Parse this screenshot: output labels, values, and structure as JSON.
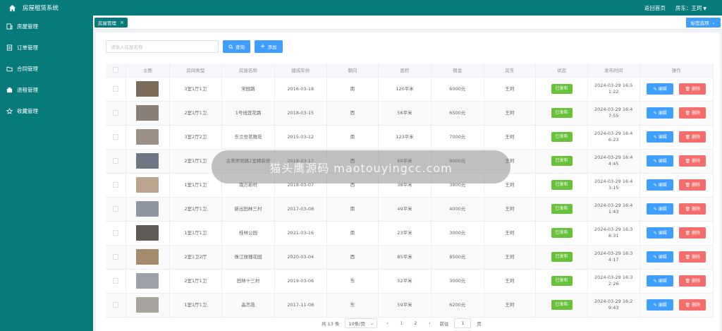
{
  "header": {
    "brand": "房屋租赁系统",
    "back_home": "返回首页",
    "user": "房东：王珂",
    "home_icon": "home-icon"
  },
  "sidebar": {
    "items": [
      {
        "label": "房屋管理",
        "icon": "building-icon"
      },
      {
        "label": "订单管理",
        "icon": "order-icon"
      },
      {
        "label": "合同管理",
        "icon": "folder-icon"
      },
      {
        "label": "退租管理",
        "icon": "checkout-icon"
      },
      {
        "label": "收藏管理",
        "icon": "star-icon"
      }
    ]
  },
  "tags": {
    "active_tag": "房屋管理",
    "close_symbol": "×",
    "options_label": "标签选项"
  },
  "toolbar": {
    "search_placeholder": "请输入房屋名称",
    "search_label": "查询",
    "add_label": "添加"
  },
  "table": {
    "columns": [
      "主图",
      "房间类型",
      "房屋名称",
      "建成年份",
      "朝向",
      "面积",
      "租金",
      "房东",
      "状态",
      "发布时间",
      "操作"
    ],
    "edit_label": "编辑",
    "delete_label": "删除",
    "rows": [
      {
        "type": "3室1厅1卫",
        "name": "宋园路",
        "year": "2016-03-18",
        "dir": "南",
        "area": "120平米",
        "rent": "6000元",
        "owner": "王珂",
        "status": "已发布",
        "time": "2024-03-29 16:5 1:22",
        "thumb": "#7b6a58"
      },
      {
        "type": "2室1厅1卫",
        "name": "1号线莲花路",
        "year": "2018-03-15",
        "dir": "西",
        "area": "56平米",
        "rent": "6500元",
        "owner": "王珂",
        "status": "已发布",
        "time": "2024-03-29 16:4 7:55",
        "thumb": "#8a7f76"
      },
      {
        "type": "3室2厅2卫",
        "name": "东兰世茗雅苑",
        "year": "2015-03-12",
        "dir": "南",
        "area": "123平米",
        "rent": "7000元",
        "owner": "王珂",
        "status": "已发布",
        "time": "2024-03-29 16:4 6:23",
        "thumb": "#9c8f86"
      },
      {
        "type": "2室1厅1卫",
        "name": "古美罗阳路2室精装修",
        "year": "2018-03-17",
        "dir": "西",
        "area": "60平米",
        "rent": "6000元",
        "owner": "王珂",
        "status": "已发布",
        "time": "2024-03-29 16:4 4:45",
        "thumb": "#6f7784"
      },
      {
        "type": "1室1厅1卫",
        "name": "南方新村",
        "year": "2018-03-07",
        "dir": "西",
        "area": "38平米",
        "rent": "3800元",
        "owner": "王珂",
        "status": "已发布",
        "time": "2024-03-29 16:4 3:15",
        "thumb": "#b9a58b"
      },
      {
        "type": "2室1厅1卫",
        "name": "新出田林三村",
        "year": "2017-03-08",
        "dir": "南",
        "area": "49平米",
        "rent": "4000元",
        "owner": "王珂",
        "status": "已发布",
        "time": "2024-03-29 16:4 1:43",
        "thumb": "#8d96a1"
      },
      {
        "type": "1室1厅1卫",
        "name": "桂林公园",
        "year": "2021-03-16",
        "dir": "南",
        "area": "23平米",
        "rent": "3000元",
        "owner": "王珂",
        "status": "已发布",
        "time": "2024-03-29 16:3 8:31",
        "thumb": "#5e5a55"
      },
      {
        "type": "2室1卫2厅",
        "name": "珠江玫瑰花园",
        "year": "2020-03-04",
        "dir": "西",
        "area": "85平米",
        "rent": "8500元",
        "owner": "王珂",
        "status": "已发布",
        "time": "2024-03-29 16:3 4:17",
        "thumb": "#a48b6d"
      },
      {
        "type": "2室1厅1卫",
        "name": "田林十三村",
        "year": "2019-03-06",
        "dir": "东",
        "area": "52平米",
        "rent": "3000元",
        "owner": "王珂",
        "status": "已发布",
        "time": "2024-03-29 16:3 2:26",
        "thumb": "#9da2aa"
      },
      {
        "type": "1室1厅1卫",
        "name": "晶杰苑",
        "year": "2017-11-08",
        "dir": "东",
        "area": "59平米",
        "rent": "6200元",
        "owner": "王珂",
        "status": "已发布",
        "time": "2024-03-29 16:2 9:43",
        "thumb": "#a7a29b"
      }
    ]
  },
  "pagination": {
    "total": "共 13 条",
    "page_size": "10条/页",
    "prev": "‹",
    "next": "›",
    "pages": [
      "1",
      "2"
    ],
    "goto_label": "前往",
    "goto_value": "1",
    "page_unit": "页"
  },
  "watermark": {
    "text": "猫头鹰源码 maotouyingcc.com"
  }
}
